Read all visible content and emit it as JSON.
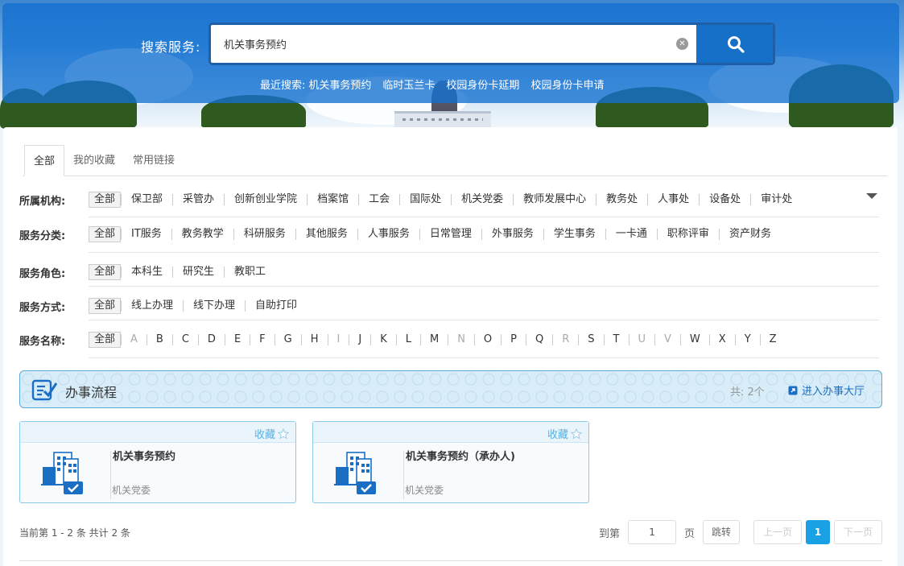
{
  "search": {
    "label": "搜索服务:",
    "value": "机关事务预约",
    "recent_label": "最近搜索:",
    "recent": [
      "机关事务预约",
      "临时玉兰卡",
      "校园身份卡延期",
      "校园身份卡申请"
    ]
  },
  "tabs": [
    "全部",
    "我的收藏",
    "常用链接"
  ],
  "filters": {
    "org": {
      "label": "所属机构:",
      "options": [
        "全部",
        "保卫部",
        "采管办",
        "创新创业学院",
        "档案馆",
        "工会",
        "国际处",
        "机关党委",
        "教师发展中心",
        "教务处",
        "人事处",
        "设备处",
        "审计处"
      ]
    },
    "category": {
      "label": "服务分类:",
      "options": [
        "全部",
        "IT服务",
        "教务教学",
        "科研服务",
        "其他服务",
        "人事服务",
        "日常管理",
        "外事服务",
        "学生事务",
        "一卡通",
        "职称评审",
        "资产财务"
      ]
    },
    "role": {
      "label": "服务角色:",
      "options": [
        "全部",
        "本科生",
        "研究生",
        "教职工"
      ]
    },
    "mode": {
      "label": "服务方式:",
      "options": [
        "全部",
        "线上办理",
        "线下办理",
        "自助打印"
      ]
    },
    "name": {
      "label": "服务名称:",
      "options": [
        "全部",
        "A",
        "B",
        "C",
        "D",
        "E",
        "F",
        "G",
        "H",
        "I",
        "J",
        "K",
        "L",
        "M",
        "N",
        "O",
        "P",
        "Q",
        "R",
        "S",
        "T",
        "U",
        "V",
        "W",
        "X",
        "Y",
        "Z"
      ],
      "disabled": [
        "A",
        "I",
        "N",
        "R",
        "U",
        "V"
      ]
    }
  },
  "flow": {
    "title": "办事流程",
    "count": "共: 2个",
    "hall_link": "进入办事大厅"
  },
  "cards": [
    {
      "fav": "收藏",
      "title": "机关事务预约",
      "dept": "机关党委"
    },
    {
      "fav": "收藏",
      "title": "机关事务预约（承办人)",
      "dept": "机关党委"
    }
  ],
  "pager": {
    "info": "当前第 1 - 2 条 共计 2 条",
    "goto_label": "到第",
    "page_input": "1",
    "page_unit": "页",
    "jump": "跳转",
    "prev": "上一页",
    "current": "1",
    "next": "下一页"
  },
  "colors": {
    "header": "#1270d0",
    "accent": "#1aa0e4",
    "link": "#1a6fc4"
  }
}
